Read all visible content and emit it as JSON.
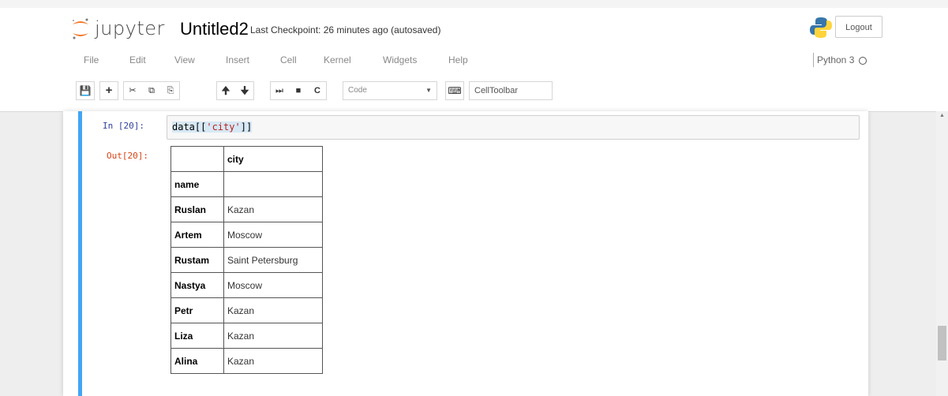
{
  "header": {
    "logo_text": "jupyter",
    "notebook_name": "Untitled2",
    "checkpoint": "Last Checkpoint: 26 minutes ago (autosaved)",
    "logout_label": "Logout"
  },
  "menu": {
    "items": [
      "File",
      "Edit",
      "View",
      "Insert",
      "Cell",
      "Kernel",
      "Widgets",
      "Help"
    ],
    "kernel": "Python 3"
  },
  "toolbar": {
    "cell_type": "Code",
    "celltoolbar_label": "CellToolbar",
    "icons": [
      "save-icon",
      "plus-icon",
      "cut-icon",
      "copy-icon",
      "paste-icon",
      "arrow-up-icon",
      "arrow-down-icon",
      "step-forward-icon",
      "stop-icon",
      "restart-icon",
      "keyboard-icon"
    ]
  },
  "cell": {
    "in_prompt": "In [20]:",
    "code": {
      "prefix": "data[[",
      "string": "'city'",
      "suffix": "]]"
    },
    "out_prompt": "Out[20]:"
  },
  "table": {
    "column_header": "city",
    "index_name": "name",
    "rows": [
      {
        "name": "Ruslan",
        "city": "Kazan"
      },
      {
        "name": "Artem",
        "city": "Moscow"
      },
      {
        "name": "Rustam",
        "city": "Saint Petersburg"
      },
      {
        "name": "Nastya",
        "city": "Moscow"
      },
      {
        "name": "Petr",
        "city": "Kazan"
      },
      {
        "name": "Liza",
        "city": "Kazan"
      },
      {
        "name": "Alina",
        "city": "Kazan"
      }
    ]
  },
  "colors": {
    "cell_marker": "#42a5f5",
    "in_prompt": "#303f9f",
    "out_prompt": "#d84315",
    "logo_orange": "#f37726"
  }
}
